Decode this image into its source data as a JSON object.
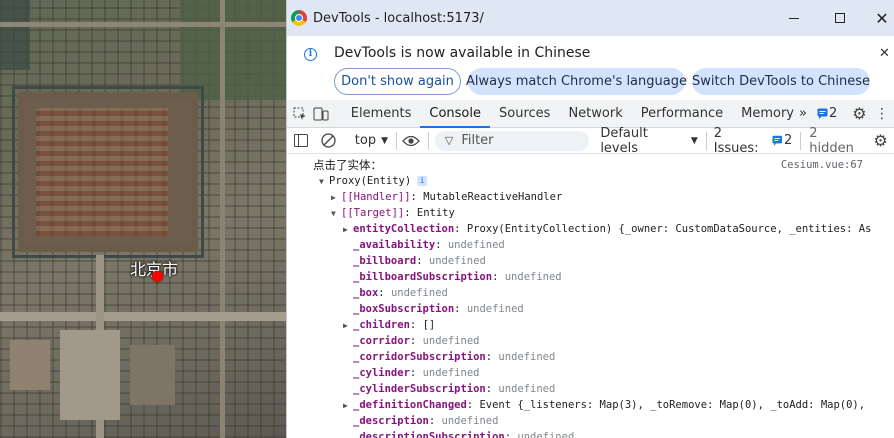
{
  "map": {
    "city_label": "北京市",
    "marker_color": "#ff0000"
  },
  "window": {
    "title": "DevTools - localhost:5173/",
    "min_icon": "minimize-icon",
    "max_icon": "maximize-icon",
    "close_label": "✕"
  },
  "infobar": {
    "message": "DevTools is now available in Chinese",
    "buttons": [
      "Don't show again",
      "Always match Chrome's language",
      "Switch DevTools to Chinese"
    ],
    "close_label": "✕"
  },
  "tabs": {
    "items": [
      "Elements",
      "Console",
      "Sources",
      "Network",
      "Performance",
      "Memory"
    ],
    "active": "Console",
    "more": "»",
    "issues_badge": "2"
  },
  "console_bar": {
    "context": "top",
    "filter_placeholder": "Filter",
    "levels": "Default levels",
    "issues_label": "2 Issues:",
    "issues_count": "2",
    "hidden": "2 hidden"
  },
  "console": {
    "message": "点击了实体：",
    "source": "Cesium.vue:67",
    "lines": [
      {
        "indent": 1,
        "tri": "▼",
        "text": "Proxy(Entity)",
        "badge": "i"
      },
      {
        "indent": 2,
        "tri": "▶",
        "key": "[[Handler]]",
        "value": "MutableReactiveHandler",
        "plain": true
      },
      {
        "indent": 2,
        "tri": "▼",
        "key": "[[Target]]",
        "value": "Entity",
        "plain": true
      },
      {
        "indent": 3,
        "tri": "▶",
        "key": "entityCollection",
        "value": "Proxy(EntityCollection)  {_owner: CustomDataSource, _entities: As"
      },
      {
        "indent": 3,
        "tri": "",
        "key": "_availability",
        "value": "undefined",
        "undef": true
      },
      {
        "indent": 3,
        "tri": "",
        "key": "_billboard",
        "value": "undefined",
        "undef": true
      },
      {
        "indent": 3,
        "tri": "",
        "key": "_billboardSubscription",
        "value": "undefined",
        "undef": true
      },
      {
        "indent": 3,
        "tri": "",
        "key": "_box",
        "value": "undefined",
        "undef": true
      },
      {
        "indent": 3,
        "tri": "",
        "key": "_boxSubscription",
        "value": "undefined",
        "undef": true
      },
      {
        "indent": 3,
        "tri": "▶",
        "key": "_children",
        "value": "[]"
      },
      {
        "indent": 3,
        "tri": "",
        "key": "_corridor",
        "value": "undefined",
        "undef": true
      },
      {
        "indent": 3,
        "tri": "",
        "key": "_corridorSubscription",
        "value": "undefined",
        "undef": true
      },
      {
        "indent": 3,
        "tri": "",
        "key": "_cylinder",
        "value": "undefined",
        "undef": true
      },
      {
        "indent": 3,
        "tri": "",
        "key": "_cylinderSubscription",
        "value": "undefined",
        "undef": true
      },
      {
        "indent": 3,
        "tri": "▶",
        "key": "_definitionChanged",
        "value": "Event  {_listeners: Map(3), _toRemove: Map(0), _toAdd: Map(0),"
      },
      {
        "indent": 3,
        "tri": "",
        "key": "_description",
        "value": "undefined",
        "undef": true
      },
      {
        "indent": 3,
        "tri": "",
        "key": "_descriptionSubscription",
        "value": "undefined",
        "undef": true
      }
    ]
  },
  "colors": {
    "titlebar": "#dfe7f5",
    "accent": "#1a73e8",
    "property_key": "#881280"
  }
}
